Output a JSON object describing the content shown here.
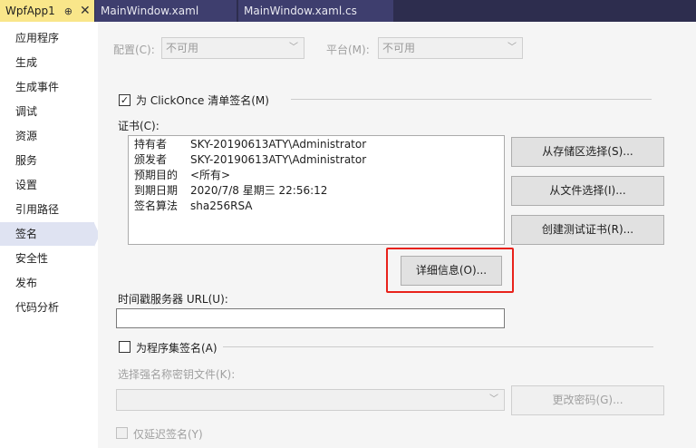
{
  "tabs": {
    "active": {
      "label": "WpfApp1",
      "pin_glyph": "⊕",
      "close_glyph": "✕"
    },
    "inactive": [
      {
        "label": "MainWindow.xaml"
      },
      {
        "label": "MainWindow.xaml.cs"
      }
    ]
  },
  "sidebar": {
    "items": [
      {
        "label": "应用程序"
      },
      {
        "label": "生成"
      },
      {
        "label": "生成事件"
      },
      {
        "label": "调试"
      },
      {
        "label": "资源"
      },
      {
        "label": "服务"
      },
      {
        "label": "设置"
      },
      {
        "label": "引用路径"
      },
      {
        "label": "签名"
      },
      {
        "label": "安全性"
      },
      {
        "label": "发布"
      },
      {
        "label": "代码分析"
      }
    ],
    "selected_index": 8
  },
  "config": {
    "label": "配置(C):",
    "value": "不可用",
    "platform_label": "平台(M):",
    "platform_value": "不可用",
    "chevron": "﹀"
  },
  "clickonce": {
    "checked": true,
    "check_glyph": "✓",
    "label": "为 ClickOnce 清单签名(M)"
  },
  "certificate": {
    "label": "证书(C):",
    "rows": [
      {
        "key": "持有者",
        "value": "SKY-20190613ATY\\Administrator"
      },
      {
        "key": "颁发者",
        "value": "SKY-20190613ATY\\Administrator"
      },
      {
        "key": "预期目的",
        "value": "<所有>"
      },
      {
        "key": "到期日期",
        "value": "2020/7/8 星期三 22:56:12"
      },
      {
        "key": "签名算法",
        "value": "sha256RSA"
      }
    ],
    "buttons": {
      "from_store": "从存储区选择(S)...",
      "from_file": "从文件选择(I)...",
      "create_test": "创建测试证书(R)...",
      "details": "详细信息(O)..."
    }
  },
  "timestamp": {
    "label": "时间戳服务器 URL(U):",
    "value": ""
  },
  "assembly": {
    "checked": false,
    "label": "为程序集签名(A)",
    "key_file_label": "选择强名称密钥文件(K):",
    "key_file_value": "",
    "change_password": "更改密码(G)...",
    "delay_sign_label": "仅延迟签名(Y)"
  }
}
